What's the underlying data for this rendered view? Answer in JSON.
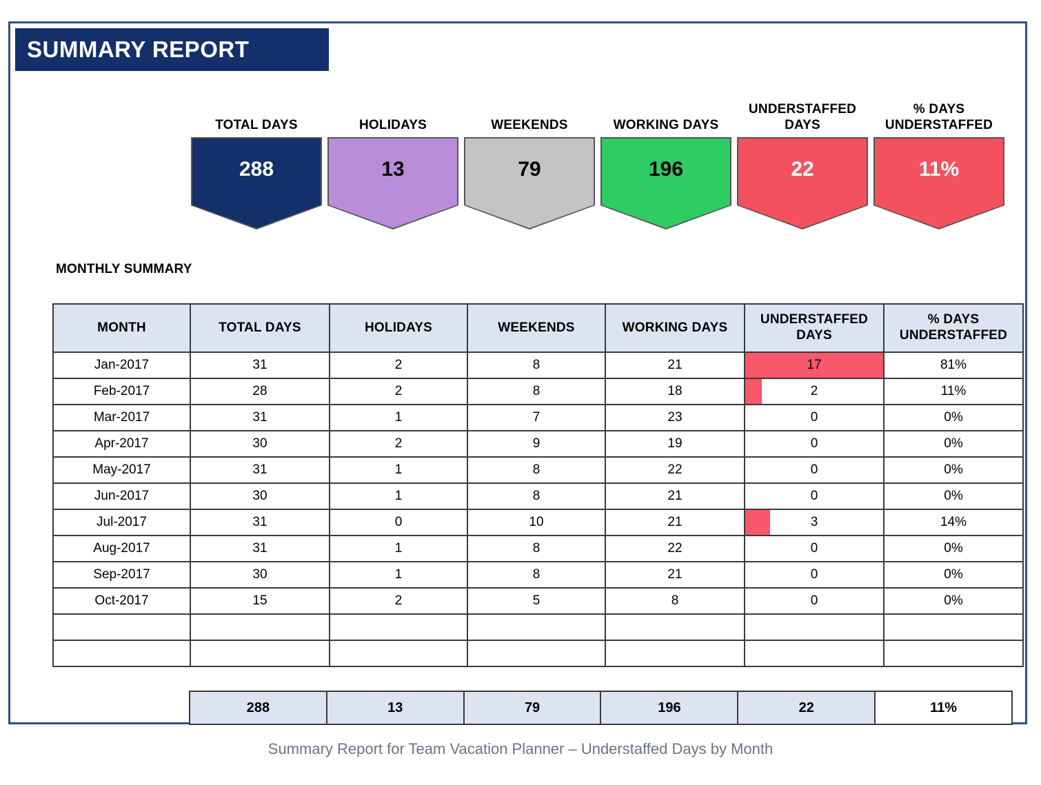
{
  "report": {
    "title": "SUMMARY REPORT",
    "section_title": "MONTHLY SUMMARY",
    "caption": "Summary Report for Team Vacation Planner – Understaffed Days by Month",
    "frame_color": "#2c5282",
    "banner_color": "#13306b"
  },
  "kpis": [
    {
      "label_line1": "TOTAL DAYS",
      "label_line2": "",
      "value": "288",
      "fill": "#13306b",
      "text_color": "#ffffff"
    },
    {
      "label_line1": "HOLIDAYS",
      "label_line2": "",
      "value": "13",
      "fill": "#ba8ddb",
      "text_color": "#000000"
    },
    {
      "label_line1": "WEEKENDS",
      "label_line2": "",
      "value": "79",
      "fill": "#c4c4c4",
      "text_color": "#000000"
    },
    {
      "label_line1": "WORKING DAYS",
      "label_line2": "",
      "value": "196",
      "fill": "#2ecc63",
      "text_color": "#000000"
    },
    {
      "label_line1": "UNDERSTAFFED",
      "label_line2": "DAYS",
      "value": "22",
      "fill": "#f4515f",
      "text_color": "#ffffff"
    },
    {
      "label_line1": "% DAYS",
      "label_line2": "UNDERSTAFFED",
      "value": "11%",
      "fill": "#f4515f",
      "text_color": "#ffffff"
    }
  ],
  "table": {
    "headers": [
      {
        "line1": "MONTH",
        "line2": ""
      },
      {
        "line1": "TOTAL DAYS",
        "line2": ""
      },
      {
        "line1": "HOLIDAYS",
        "line2": ""
      },
      {
        "line1": "WEEKENDS",
        "line2": ""
      },
      {
        "line1": "WORKING DAYS",
        "line2": ""
      },
      {
        "line1": "UNDERSTAFFED",
        "line2": "DAYS"
      },
      {
        "line1": "% DAYS",
        "line2": "UNDERSTAFFED"
      }
    ],
    "rows": [
      {
        "month": "Jan-2017",
        "total_days": "31",
        "holidays": "2",
        "weekends": "8",
        "working_days": "21",
        "understaffed_days": "17",
        "bar_pct": 100,
        "pct_understaffed": "81%"
      },
      {
        "month": "Feb-2017",
        "total_days": "28",
        "holidays": "2",
        "weekends": "8",
        "working_days": "18",
        "understaffed_days": "2",
        "bar_pct": 12,
        "pct_understaffed": "11%"
      },
      {
        "month": "Mar-2017",
        "total_days": "31",
        "holidays": "1",
        "weekends": "7",
        "working_days": "23",
        "understaffed_days": "0",
        "bar_pct": 0,
        "pct_understaffed": "0%"
      },
      {
        "month": "Apr-2017",
        "total_days": "30",
        "holidays": "2",
        "weekends": "9",
        "working_days": "19",
        "understaffed_days": "0",
        "bar_pct": 0,
        "pct_understaffed": "0%"
      },
      {
        "month": "May-2017",
        "total_days": "31",
        "holidays": "1",
        "weekends": "8",
        "working_days": "22",
        "understaffed_days": "0",
        "bar_pct": 0,
        "pct_understaffed": "0%"
      },
      {
        "month": "Jun-2017",
        "total_days": "30",
        "holidays": "1",
        "weekends": "8",
        "working_days": "21",
        "understaffed_days": "0",
        "bar_pct": 0,
        "pct_understaffed": "0%"
      },
      {
        "month": "Jul-2017",
        "total_days": "31",
        "holidays": "0",
        "weekends": "10",
        "working_days": "21",
        "understaffed_days": "3",
        "bar_pct": 18,
        "pct_understaffed": "14%"
      },
      {
        "month": "Aug-2017",
        "total_days": "31",
        "holidays": "1",
        "weekends": "8",
        "working_days": "22",
        "understaffed_days": "0",
        "bar_pct": 0,
        "pct_understaffed": "0%"
      },
      {
        "month": "Sep-2017",
        "total_days": "30",
        "holidays": "1",
        "weekends": "8",
        "working_days": "21",
        "understaffed_days": "0",
        "bar_pct": 0,
        "pct_understaffed": "0%"
      },
      {
        "month": "Oct-2017",
        "total_days": "15",
        "holidays": "2",
        "weekends": "5",
        "working_days": "8",
        "understaffed_days": "0",
        "bar_pct": 0,
        "pct_understaffed": "0%"
      },
      {
        "month": "",
        "total_days": "",
        "holidays": "",
        "weekends": "",
        "working_days": "",
        "understaffed_days": "",
        "bar_pct": 0,
        "pct_understaffed": ""
      },
      {
        "month": "",
        "total_days": "",
        "holidays": "",
        "weekends": "",
        "working_days": "",
        "understaffed_days": "",
        "bar_pct": 0,
        "pct_understaffed": ""
      }
    ],
    "bar_color": "#f9576a",
    "header_bg": "#dce4f2"
  },
  "totals": {
    "total_days": "288",
    "holidays": "13",
    "weekends": "79",
    "working_days": "196",
    "understaffed_days": "22",
    "pct_understaffed": "11%"
  },
  "chart_data": {
    "type": "table",
    "title": "Summary Report for Team Vacation Planner – Understaffed Days by Month",
    "xlabel": "Month",
    "ylabel": "Understaffed Days",
    "categories": [
      "Jan-2017",
      "Feb-2017",
      "Mar-2017",
      "Apr-2017",
      "May-2017",
      "Jun-2017",
      "Jul-2017",
      "Aug-2017",
      "Sep-2017",
      "Oct-2017"
    ],
    "series": [
      {
        "name": "Total Days",
        "values": [
          31,
          28,
          31,
          30,
          31,
          30,
          31,
          31,
          30,
          15
        ]
      },
      {
        "name": "Holidays",
        "values": [
          2,
          2,
          1,
          2,
          1,
          1,
          0,
          1,
          1,
          2
        ]
      },
      {
        "name": "Weekends",
        "values": [
          8,
          8,
          7,
          9,
          8,
          8,
          10,
          8,
          8,
          5
        ]
      },
      {
        "name": "Working Days",
        "values": [
          21,
          18,
          23,
          19,
          22,
          21,
          21,
          22,
          21,
          8
        ]
      },
      {
        "name": "Understaffed Days",
        "values": [
          17,
          2,
          0,
          0,
          0,
          0,
          3,
          0,
          0,
          0
        ]
      },
      {
        "name": "% Days Understaffed",
        "values": [
          81,
          11,
          0,
          0,
          0,
          0,
          14,
          0,
          0,
          0
        ]
      }
    ],
    "totals": {
      "total_days": 288,
      "holidays": 13,
      "weekends": 79,
      "working_days": 196,
      "understaffed_days": 22,
      "pct_understaffed": 11
    },
    "ylim": [
      0,
      17
    ],
    "grid": true,
    "legend": "none"
  }
}
